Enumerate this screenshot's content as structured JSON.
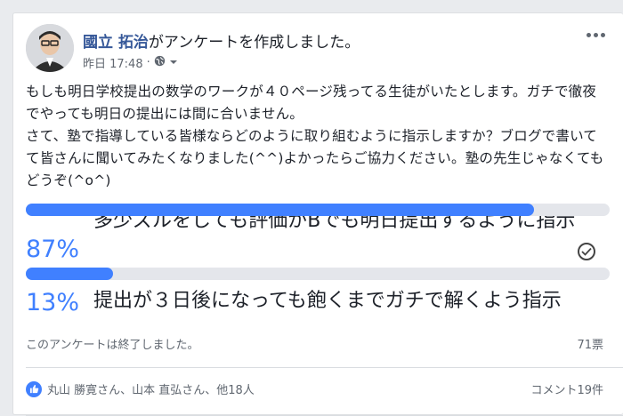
{
  "post": {
    "author": "國立 拓治",
    "action": "がアンケートを作成しました。",
    "time": "昨日 17:48",
    "separator": "·",
    "privacy_icon": "globe-icon",
    "body": "もしも明日学校提出の数学のワークが４０ページ残ってる生徒がいたとします。ガチで徹夜でやっても明日の提出には間に合いません。\nさて、塾で指導している皆様ならどのように取り組むように指示しますか？ブログで書いてて皆さんに聞いてみたくなりました(^^)よかったらご協力ください。塾の先生じゃなくてもどうぞ(^o^)"
  },
  "poll": {
    "options": [
      {
        "percent_label": "87%",
        "percent": 87,
        "text": "多少ズルをしても評価がBでも明日提出するように指示",
        "selected": true
      },
      {
        "percent_label": "13%",
        "percent": 13,
        "text": "提出が３日後になっても飽くまでガチで解くよう指示",
        "selected": false
      }
    ],
    "status": "このアンケートは終了しました。",
    "votes": "71票"
  },
  "footer": {
    "likes": "丸山 勝寛さん、山本 直弘さん、他18人",
    "comments": "コメント19件"
  },
  "colors": {
    "accent": "#4080ff",
    "link": "#365899",
    "track": "#e4e6eb"
  }
}
